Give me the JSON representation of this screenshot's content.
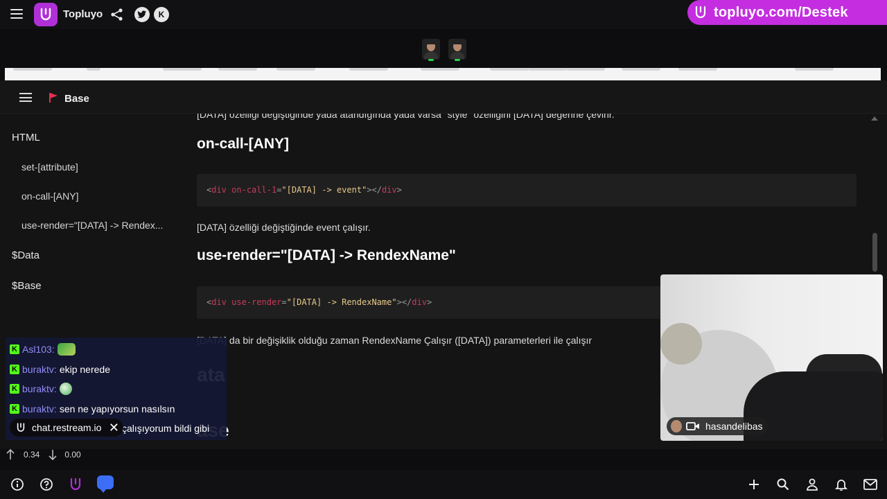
{
  "header": {
    "brand": "Topluyo",
    "promo_url": "topluyo.com/Destek",
    "promo_color": "#c42ee0",
    "icons": [
      "menu-icon",
      "share-icon",
      "twitter-icon",
      "kick-icon"
    ]
  },
  "app": {
    "title": "Base",
    "sidebar": {
      "items": [
        {
          "label": "HTML"
        },
        {
          "label": "set-[attribute]"
        },
        {
          "label": "on-call-[ANY]"
        },
        {
          "label": "use-render=\"[DATA] -> Rendex..."
        },
        {
          "label": "$Data"
        },
        {
          "label": "$Base"
        }
      ]
    },
    "content": {
      "text_top": "[DATA] özelliği değiştiğinde yada atandığında yada varsa \"style\" özelliğini [DATA] değerine çevirir.",
      "heading1": "on-call-[ANY]",
      "code1": {
        "open": "<",
        "tag": "div",
        "attr": "on-call-1",
        "eq": "=",
        "value": "\"[DATA] -> event\"",
        "close": "></",
        "tag2": "div",
        "end": ">"
      },
      "text1": "[DATA] özelliği değiştiğinde event çalışır.",
      "heading2": "use-render=\"[DATA] -> RendexName\"",
      "code2": {
        "open": "<",
        "tag": "div",
        "attr": "use-render",
        "eq": "=",
        "value": "\"[DATA] -> RendexName\"",
        "close": "></",
        "tag2": "div",
        "end": ">"
      },
      "text2": "] da bir değişiklik olduğu zaman RendexName Çalışır ([DATA]) parameterleri ile çalışır",
      "text2_prefix": "[DATA",
      "heading3": "ata",
      "heading4": "ase"
    }
  },
  "chat": {
    "messages": [
      {
        "user": "Asl103",
        "text": "",
        "emote": "frog-emote"
      },
      {
        "user": "buraktv",
        "text": "ekip nerede",
        "emote": ""
      },
      {
        "user": "buraktv",
        "text": "",
        "emote": "bubble-emote"
      },
      {
        "user": "buraktv",
        "text": "sen ne yapıyorsun nasılsın",
        "emote": ""
      },
      {
        "user": "",
        "text": "çalışıyorum bildi gibi",
        "emote": ""
      }
    ],
    "source_label": "chat.restream.io"
  },
  "webcam": {
    "username": "hasandelibas"
  },
  "stats": {
    "up": "0.34",
    "down": "0.00"
  },
  "bottom_icons": [
    "info-icon",
    "help-icon",
    "topluyo-icon",
    "chat-icon",
    "plus-icon",
    "search-icon",
    "user-icon",
    "bell-icon",
    "mail-icon"
  ]
}
